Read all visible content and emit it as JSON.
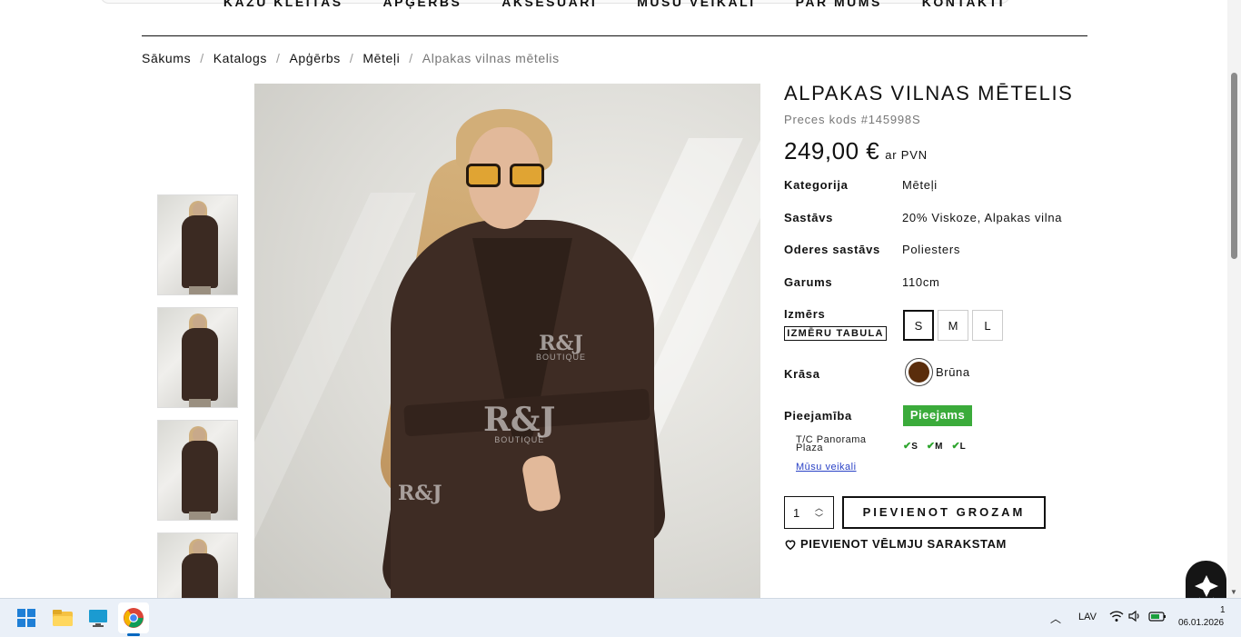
{
  "nav": {
    "items": [
      "Kāzu kleitas",
      "Apģērbs",
      "Aksesuāri",
      "Mūsu veikali",
      "Par mums",
      "Kontakti"
    ]
  },
  "breadcrumb": {
    "items": [
      "Sākums",
      "Katalogs",
      "Apģērbs",
      "Mēteļi",
      "Alpakas vilnas mētelis"
    ],
    "separator": "/"
  },
  "gallery": {
    "thumbnails": [
      "thumb-1",
      "thumb-2",
      "thumb-3",
      "thumb-4"
    ],
    "watermark": "R&J",
    "watermark_sub": "BOUTIQUE"
  },
  "product": {
    "title": "ALPAKAS VILNAS MĒTELIS",
    "sku": "Preces kods #145998S",
    "price": "249,00 €",
    "vat": "ar PVN"
  },
  "attributes": {
    "category_label": "Kategorija",
    "category_value": "Mēteļi",
    "composition_label": "Sastāvs",
    "composition_value": "20% Viskoze, Alpakas vilna",
    "lining_label": "Oderes sastāvs",
    "lining_value": "Poliesters",
    "length_label": "Garums",
    "length_value": "110cm",
    "size_label": "Izmērs",
    "size_chart_button": "IZMĒRU TABULA",
    "sizes": [
      "S",
      "M",
      "L"
    ],
    "selected_size": "S",
    "color_label": "Krāsa",
    "color_name": "Brūna",
    "color_hex": "#5a2d0c",
    "availability_label": "Pieejamība",
    "availability_badge": "Pieejams",
    "availability_color": "#3bab3b"
  },
  "stores": {
    "store_name": "T/C Panorama Plaza",
    "stock": [
      "S",
      "M",
      "L"
    ],
    "link": "Mūsu veikali"
  },
  "cart": {
    "quantity": "1",
    "add_to_cart": "PIEVIENOT GROZAM",
    "wishlist": "PIEVIENOT VĒLMJU SARAKSTAM"
  },
  "taskbar": {
    "language": "LAV",
    "clock_time": "1",
    "clock_date": "06.01.2026",
    "icons": [
      "windows-start-icon",
      "file-explorer-icon",
      "desktop-icon",
      "chrome-icon"
    ]
  }
}
